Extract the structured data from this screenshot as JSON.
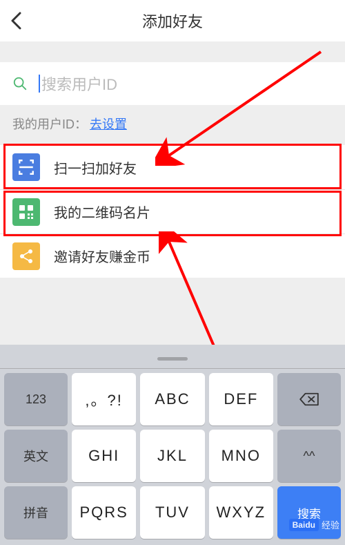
{
  "header": {
    "title": "添加好友"
  },
  "search": {
    "placeholder": "搜索用户ID"
  },
  "userid": {
    "label": "我的用户ID：",
    "link": "去设置"
  },
  "options": {
    "scan": "扫一扫加好友",
    "qrcode": "我的二维码名片",
    "invite": "邀请好友赚金币"
  },
  "keyboard": {
    "side": {
      "k123": "123",
      "eng": "英文",
      "pinyin": "拼音",
      "caret": "^^"
    },
    "control": {
      "search": "搜索"
    },
    "rows": [
      [
        ",。?!",
        "ABC",
        "DEF"
      ],
      [
        "GHI",
        "JKL",
        "MNO"
      ],
      [
        "PQRS",
        "TUV",
        "WXYZ"
      ]
    ]
  },
  "watermark": {
    "brand": "Bai",
    "sub": "经验"
  }
}
